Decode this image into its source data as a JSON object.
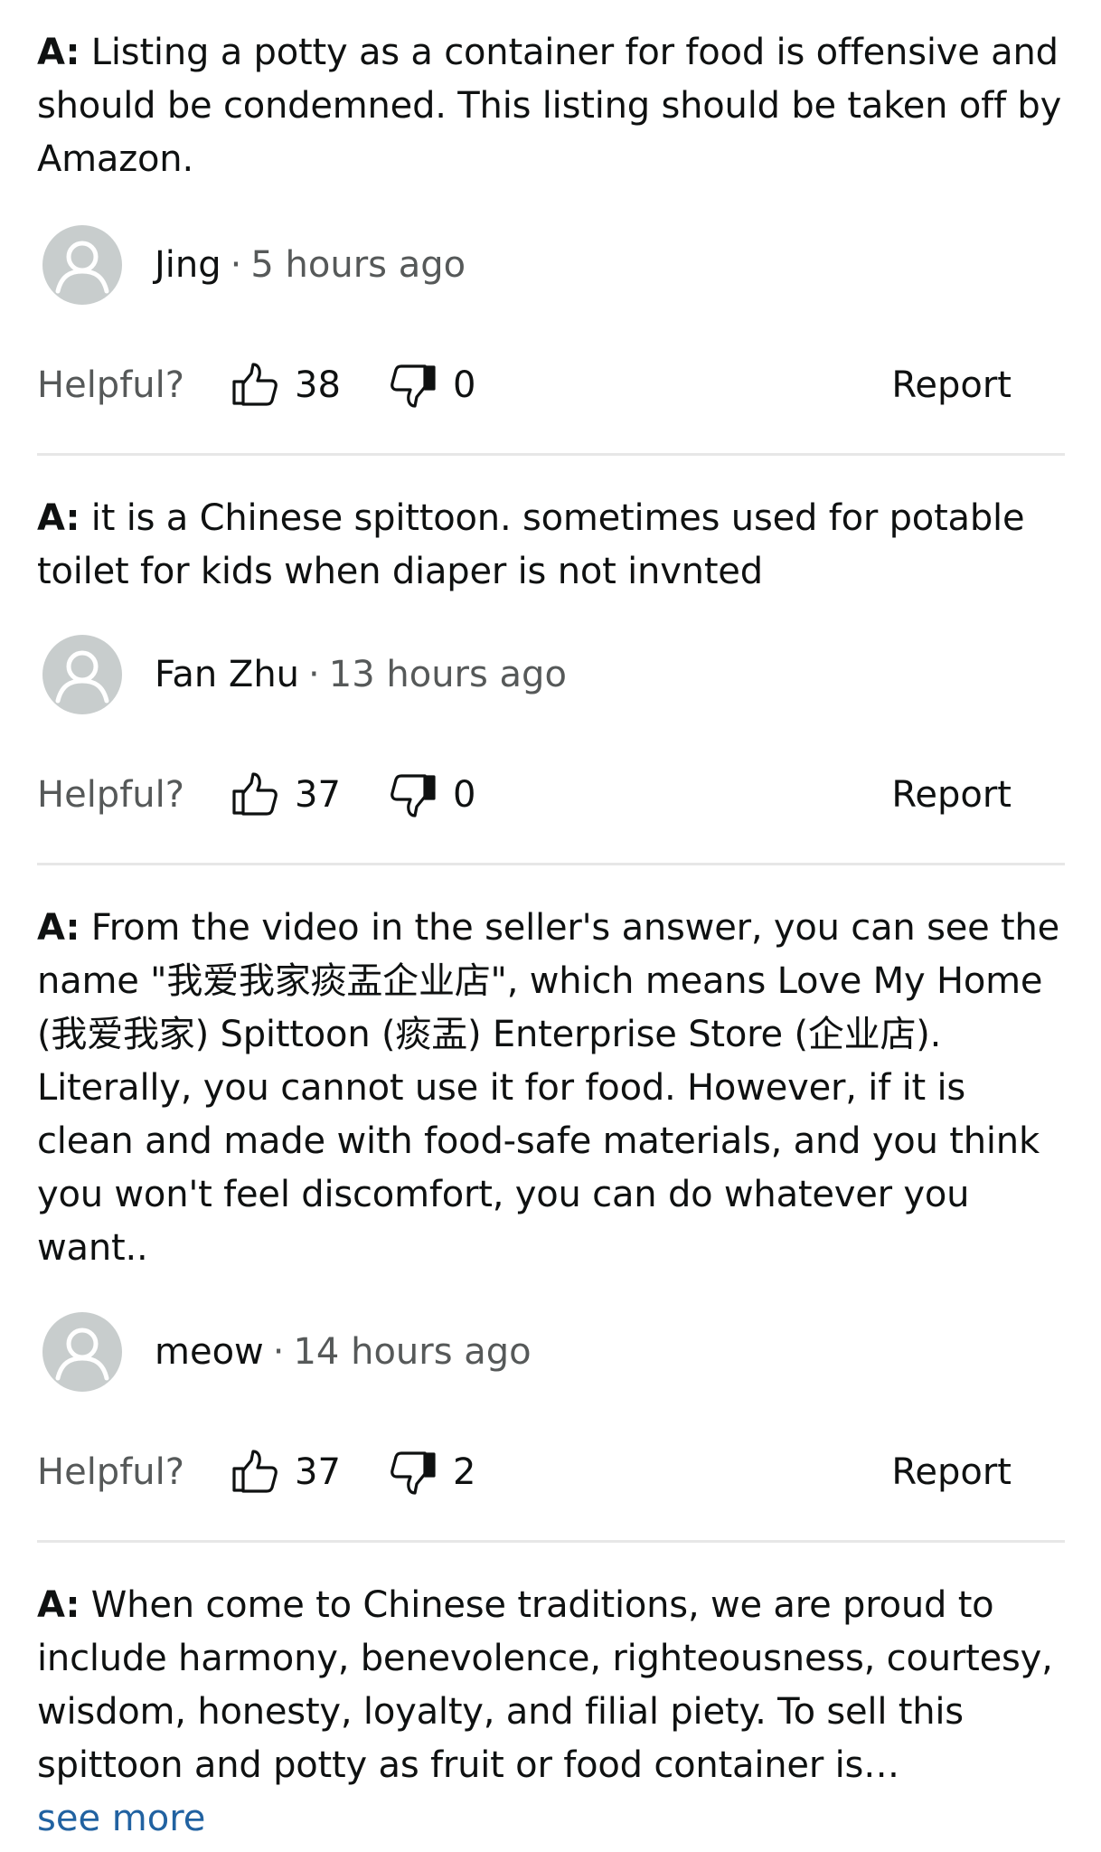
{
  "answers": [
    {
      "prefix": "A:",
      "text": " Listing a potty as a container for food is offensive and should be condemned. This listing should be taken off by Amazon.",
      "author": "Jing",
      "separator": "·",
      "time": "5 hours ago",
      "helpful_label": "Helpful?",
      "upvotes": "38",
      "downvotes": "0",
      "report_label": "Report"
    },
    {
      "prefix": "A:",
      "text": " it is a Chinese spittoon. sometimes used for potable toilet for kids when diaper is not invnted",
      "author": "Fan Zhu",
      "separator": "·",
      "time": "13 hours ago",
      "helpful_label": "Helpful?",
      "upvotes": "37",
      "downvotes": "0",
      "report_label": "Report"
    },
    {
      "prefix": "A:",
      "text": " From the video in the seller's answer, you can see the name \"我爱我家痰盂企业店\", which means Love My Home (我爱我家) Spittoon (痰盂) Enterprise Store (企业店). Literally, you cannot use it for food. However, if it is clean and made with food-safe materials, and you think you won't feel discomfort, you can do whatever you want..",
      "author": "meow",
      "separator": "·",
      "time": "14 hours ago",
      "helpful_label": "Helpful?",
      "upvotes": "37",
      "downvotes": "2",
      "report_label": "Report"
    },
    {
      "prefix": "A:",
      "text": " When come to Chinese traditions, we are proud to include harmony, benevolence, righteousness, courtesy, wisdom, honesty, loyalty, and filial piety. To sell this spittoon and potty as fruit or food container is…",
      "see_more": "see more"
    }
  ],
  "icons": {
    "avatar": "default-user-avatar-icon",
    "upvote": "thumbs-up-icon",
    "downvote": "thumbs-down-icon"
  },
  "colors": {
    "text": "#0f1111",
    "muted": "#565959",
    "link": "#2162a1",
    "avatar_bg": "#c8cdcd",
    "divider": "#e7e7e7"
  }
}
